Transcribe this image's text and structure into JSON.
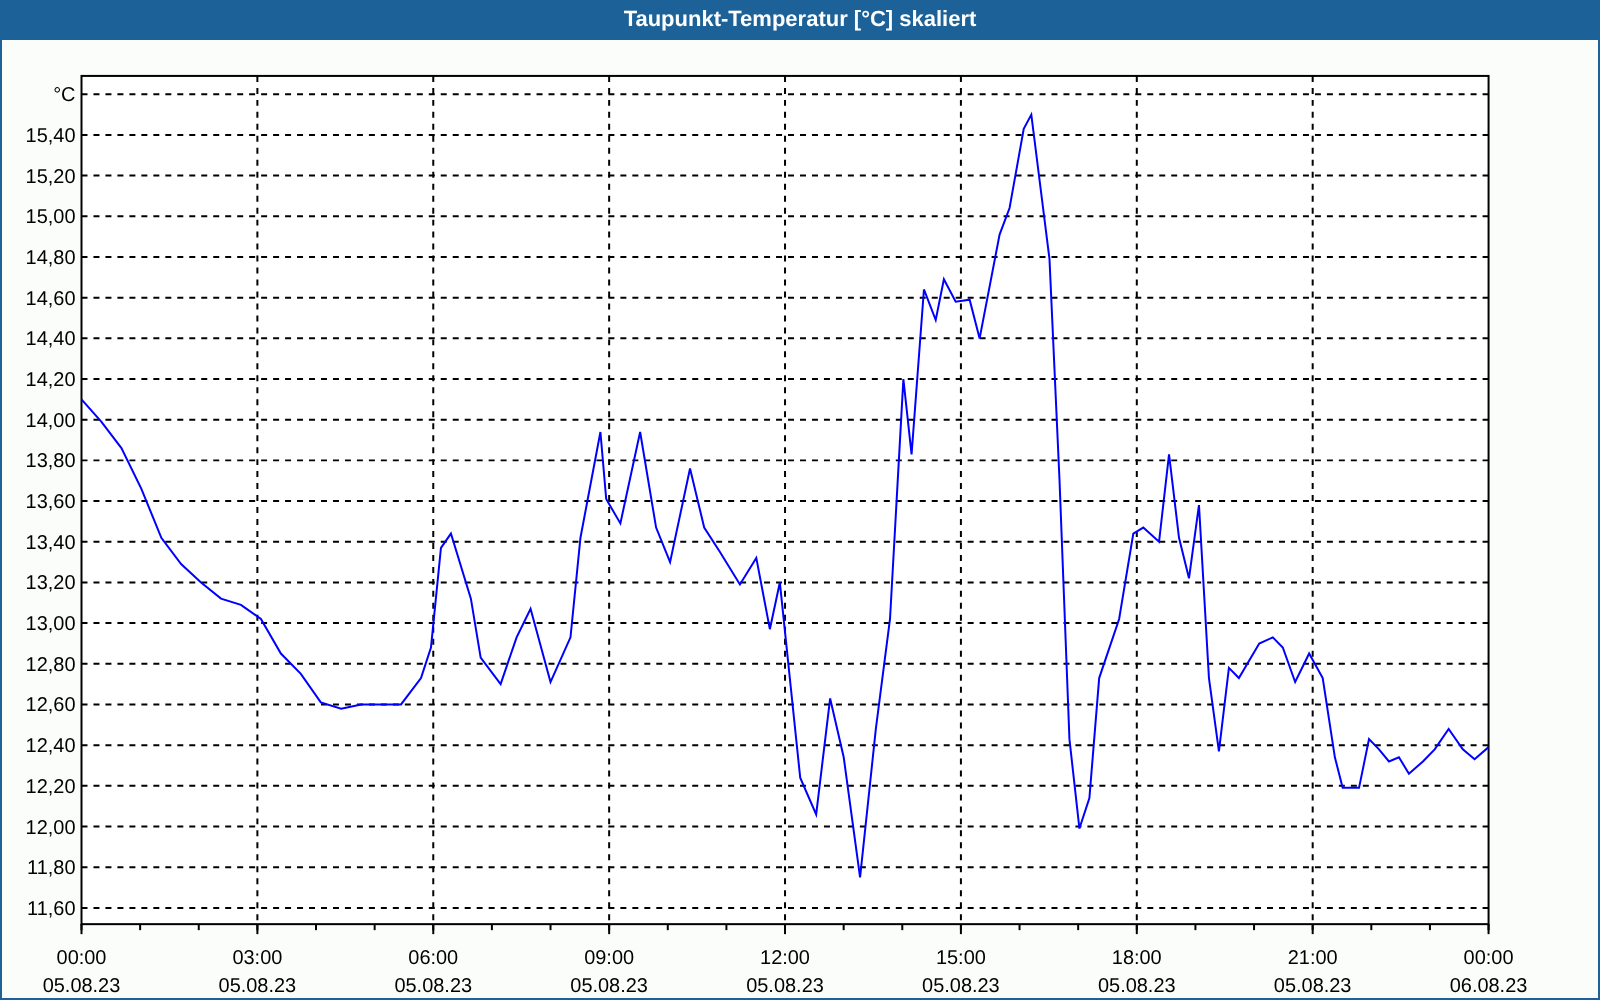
{
  "window": {
    "title": "Taupunkt-Temperatur [°C] skaliert"
  },
  "chart": {
    "chart_data": {
      "type": "line",
      "ylabel": "°C",
      "grid": true,
      "x": [
        0,
        0.34,
        0.68,
        1.02,
        1.36,
        1.7,
        2.04,
        2.38,
        2.72,
        3.06,
        3.4,
        3.74,
        4.08,
        4.43,
        4.77,
        5.45,
        5.79,
        5.96,
        6.13,
        6.3,
        6.64,
        6.81,
        7.15,
        7.42,
        7.66,
        8,
        8.34,
        8.51,
        8.85,
        8.95,
        9.19,
        9.53,
        9.8,
        10.04,
        10.38,
        10.62,
        10.89,
        11.23,
        11.51,
        11.74,
        11.91,
        12.26,
        12.53,
        12.77,
        13,
        13.28,
        13.55,
        13.79,
        14.02,
        14.16,
        14.37,
        14.57,
        14.71,
        14.91,
        15.15,
        15.32,
        15.66,
        15.83,
        16.07,
        16.2,
        16.51,
        16.68,
        16.85,
        17.02,
        17.19,
        17.36,
        17.7,
        17.94,
        18.11,
        18.38,
        18.55,
        18.72,
        18.89,
        19.06,
        19.23,
        19.4,
        19.57,
        19.74,
        20.09,
        20.32,
        20.49,
        20.7,
        20.94,
        21.17,
        21.38,
        21.51,
        21.79,
        21.96,
        22.13,
        22.3,
        22.47,
        22.64,
        22.88,
        23.08,
        23.32,
        23.56,
        23.76,
        24
      ],
      "series": [
        {
          "color": "#0000ff",
          "values": [
            14.1,
            13.99,
            13.86,
            13.66,
            13.42,
            13.29,
            13.2,
            13.12,
            13.09,
            13.02,
            12.85,
            12.75,
            12.61,
            12.58,
            12.6,
            12.6,
            12.73,
            12.88,
            13.37,
            13.44,
            13.12,
            12.83,
            12.7,
            12.93,
            13.07,
            12.71,
            12.93,
            13.42,
            13.94,
            13.61,
            13.49,
            13.94,
            13.47,
            13.3,
            13.76,
            13.47,
            13.35,
            13.19,
            13.32,
            12.97,
            13.2,
            12.24,
            12.06,
            12.63,
            12.34,
            11.75,
            12.48,
            13.02,
            14.2,
            13.83,
            14.64,
            14.49,
            14.69,
            14.58,
            14.59,
            14.4,
            14.91,
            15.04,
            15.43,
            15.5,
            14.79,
            13.71,
            12.43,
            11.99,
            12.14,
            12.73,
            13.02,
            13.44,
            13.47,
            13.4,
            13.83,
            13.42,
            13.22,
            13.58,
            12.73,
            12.37,
            12.78,
            12.73,
            12.9,
            12.93,
            12.88,
            12.71,
            12.85,
            12.73,
            12.34,
            12.19,
            12.19,
            12.43,
            12.38,
            12.32,
            12.34,
            12.26,
            12.32,
            12.38,
            12.48,
            12.38,
            12.33,
            12.39
          ]
        }
      ],
      "xlim": [
        0,
        24
      ],
      "ylim": [
        11.52,
        15.69
      ],
      "xticks": [
        {
          "value": 0,
          "label": "00:00"
        },
        {
          "value": 3,
          "label": "03:00"
        },
        {
          "value": 6,
          "label": "06:00"
        },
        {
          "value": 9,
          "label": "09:00"
        },
        {
          "value": 12,
          "label": "12:00"
        },
        {
          "value": 15,
          "label": "15:00"
        },
        {
          "value": 18,
          "label": "18:00"
        },
        {
          "value": 21,
          "label": "21:00"
        },
        {
          "value": 24,
          "label": "00:00"
        }
      ],
      "yticks": [
        {
          "value": 11.6,
          "label": "11,60"
        },
        {
          "value": 11.8,
          "label": "11,80"
        },
        {
          "value": 12,
          "label": "12,00"
        },
        {
          "value": 12.2,
          "label": "12,20"
        },
        {
          "value": 12.4,
          "label": "12,40"
        },
        {
          "value": 12.6,
          "label": "12,60"
        },
        {
          "value": 12.8,
          "label": "12,80"
        },
        {
          "value": 13,
          "label": "13,00"
        },
        {
          "value": 13.2,
          "label": "13,20"
        },
        {
          "value": 13.4,
          "label": "13,40"
        },
        {
          "value": 13.6,
          "label": "13,60"
        },
        {
          "value": 13.8,
          "label": "13,80"
        },
        {
          "value": 14,
          "label": "14,00"
        },
        {
          "value": 14.2,
          "label": "14,20"
        },
        {
          "value": 14.4,
          "label": "14,40"
        },
        {
          "value": 14.6,
          "label": "14,60"
        },
        {
          "value": 14.8,
          "label": "14,80"
        },
        {
          "value": 15,
          "label": "15,00"
        },
        {
          "value": 15.2,
          "label": "15,20"
        },
        {
          "value": 15.4,
          "label": "15,40"
        }
      ]
    },
    "date_labels": [
      "05.08.23",
      "05.08.23",
      "05.08.23",
      "05.08.23",
      "05.08.23",
      "05.08.23",
      "05.08.23",
      "05.08.23",
      "06.08.23"
    ]
  }
}
